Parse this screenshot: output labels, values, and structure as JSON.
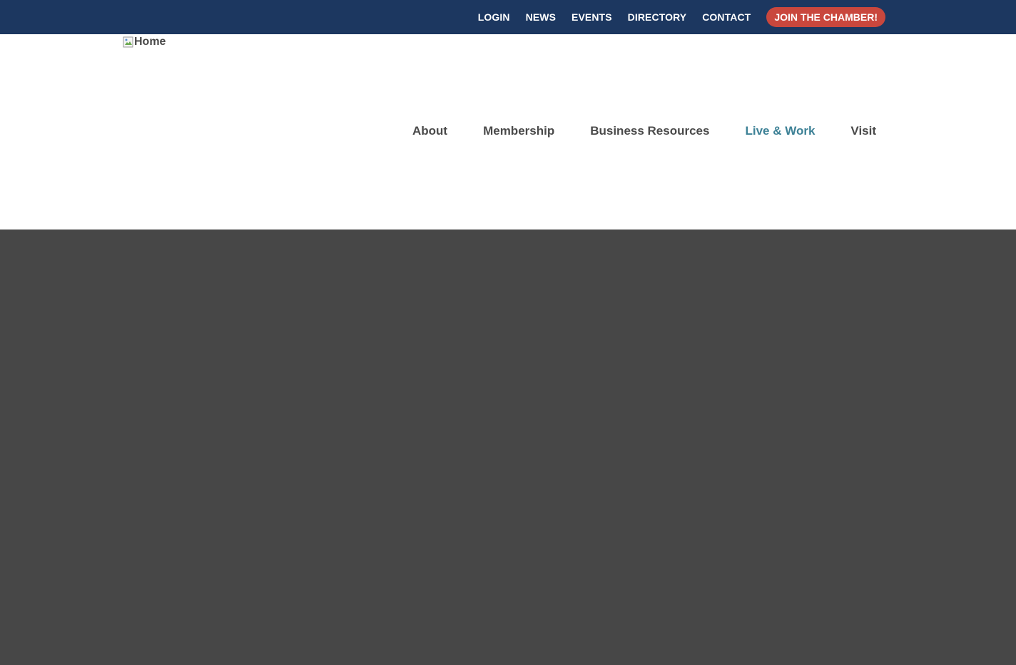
{
  "topbar": {
    "links": [
      {
        "label": "LOGIN"
      },
      {
        "label": "NEWS"
      },
      {
        "label": "EVENTS"
      },
      {
        "label": "DIRECTORY"
      },
      {
        "label": "CONTACT"
      }
    ],
    "join_label": "JOIN THE CHAMBER!",
    "background_color": "#1c3760",
    "join_color": "#c9473d"
  },
  "header": {
    "logo_alt": "Home",
    "logo_icon": "broken-image-icon",
    "nav": [
      {
        "label": "About",
        "active": false
      },
      {
        "label": "Membership",
        "active": false
      },
      {
        "label": "Business Resources",
        "active": false
      },
      {
        "label": "Live & Work",
        "active": true
      },
      {
        "label": "Visit",
        "active": false
      }
    ],
    "active_color": "#3d8196"
  },
  "hero": {
    "background_color": "#474747"
  }
}
